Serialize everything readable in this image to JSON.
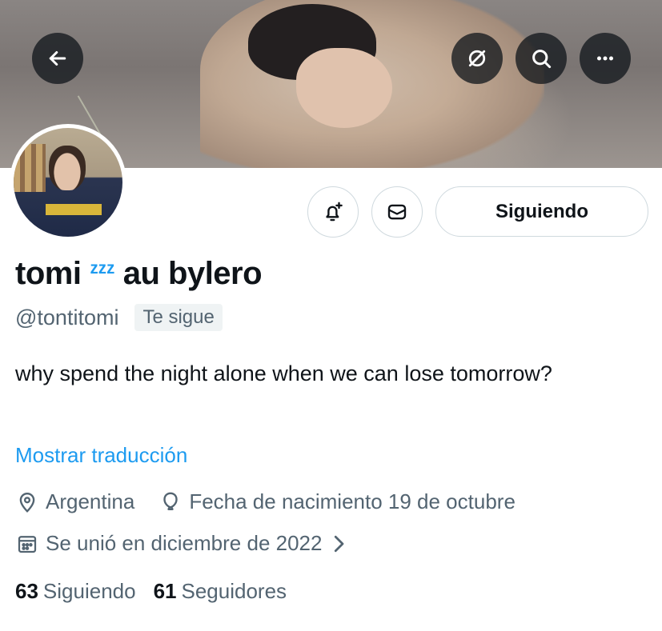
{
  "header": {
    "back_icon": "arrow-left-icon",
    "action_icons": [
      "grok-icon",
      "search-icon",
      "more-icon"
    ]
  },
  "profile": {
    "name_part1": "tomi",
    "name_emoji": "zzz",
    "name_part2": "au bylero",
    "handle": "@tontitomi",
    "follows_you": "Te sigue",
    "bio": "why spend the night alone when we can lose tomorrow?",
    "translate_link": "Mostrar traducción",
    "location": "Argentina",
    "birthday": "Fecha de nacimiento 19 de octubre",
    "joined": "Se unió en diciembre de 2022",
    "following_count": "63",
    "following_label": "Siguiendo",
    "followers_count": "61",
    "followers_label": "Seguidores"
  },
  "actions": {
    "notifications_icon": "bell-plus-icon",
    "message_icon": "envelope-icon",
    "following_button": "Siguiendo"
  },
  "colors": {
    "accent": "#1d9bf0",
    "secondary_text": "#536471",
    "border": "#cfd9de"
  }
}
